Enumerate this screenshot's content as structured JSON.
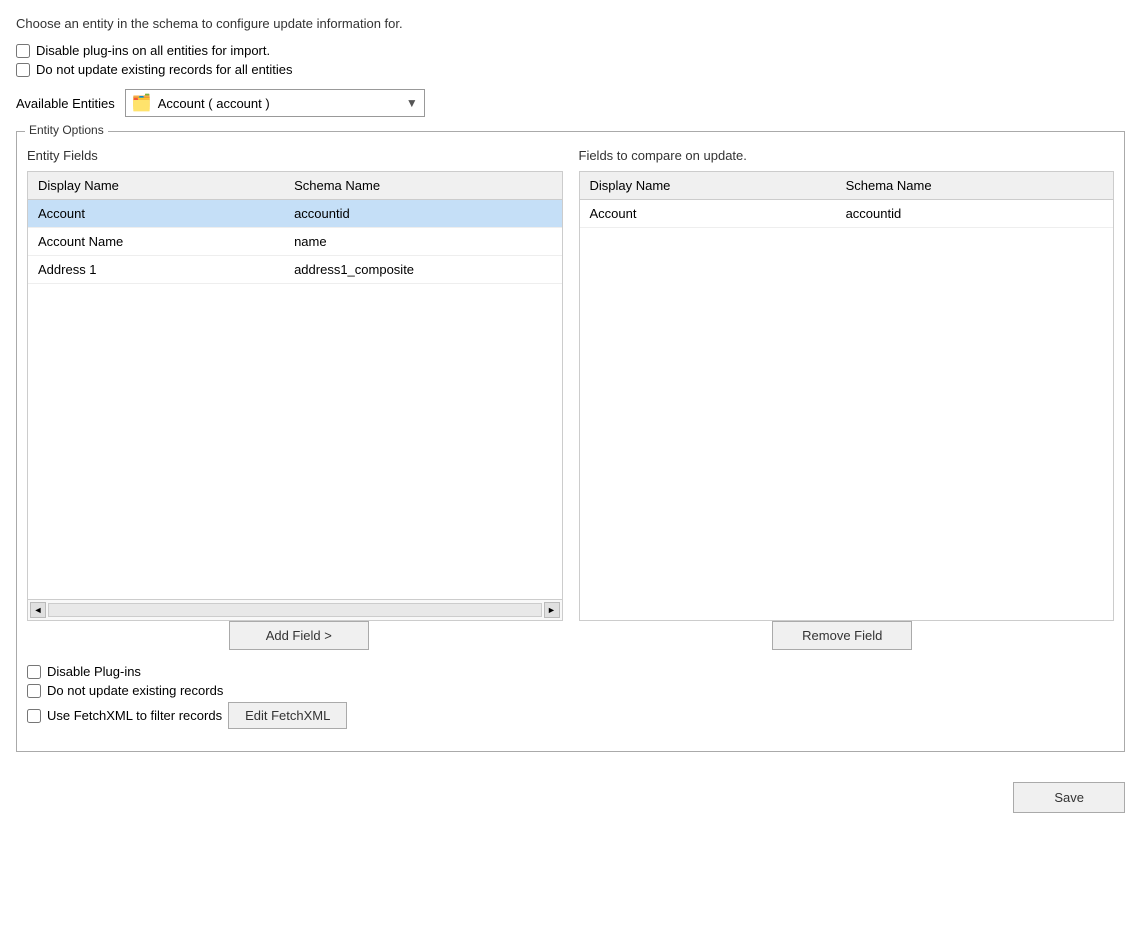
{
  "intro": {
    "text": "Choose an entity in the schema to configure update information for."
  },
  "global_options": {
    "disable_plugins_label": "Disable plug-ins on all entities for import.",
    "no_update_label": "Do not update existing records for all entities"
  },
  "available_entities": {
    "label": "Available Entities",
    "selected_value": "Account  (  account  )",
    "icon": "🗂️",
    "arrow": "▼"
  },
  "entity_options": {
    "legend": "Entity Options",
    "left_panel": {
      "title": "Entity Fields",
      "columns": [
        "Display Name",
        "Schema Name"
      ],
      "rows": [
        {
          "display_name": "Account",
          "schema_name": "accountid",
          "selected": true
        },
        {
          "display_name": "Account Name",
          "schema_name": "name",
          "selected": false
        },
        {
          "display_name": "Address 1",
          "schema_name": "address1_composite",
          "selected": false
        }
      ]
    },
    "right_panel": {
      "title": "Fields to compare on update.",
      "columns": [
        "Display Name",
        "Schema Name"
      ],
      "rows": [
        {
          "display_name": "Account",
          "schema_name": "accountid"
        }
      ]
    },
    "add_field_btn": "Add Field >",
    "remove_field_btn": "Remove Field"
  },
  "entity_checkboxes": {
    "disable_plugins_label": "Disable Plug-ins",
    "no_update_label": "Do not update existing records",
    "use_fetchxml_label": "Use FetchXML to filter records",
    "edit_fetchxml_btn": "Edit FetchXML"
  },
  "bottom": {
    "save_label": "Save"
  }
}
